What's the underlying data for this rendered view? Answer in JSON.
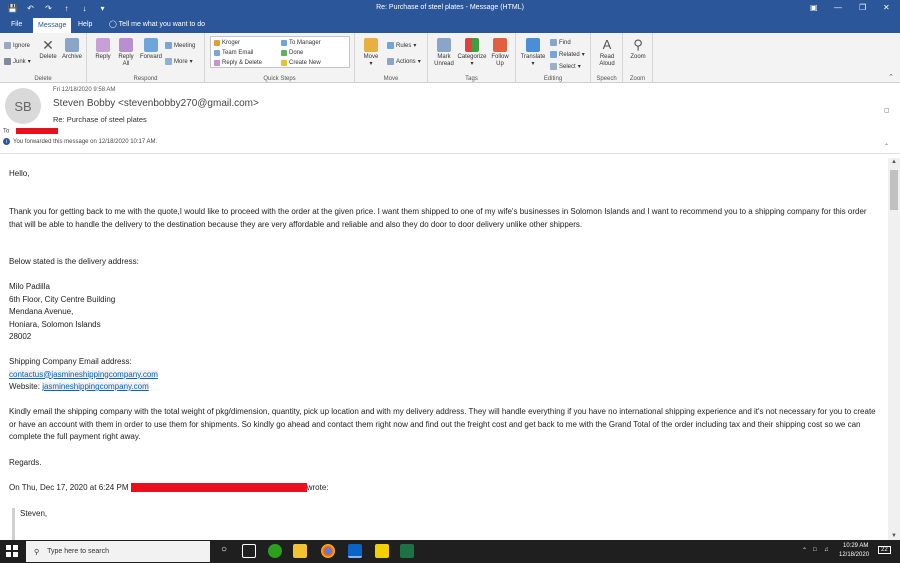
{
  "window": {
    "title": "Re: Purchase of steel plates  -  Message (HTML)"
  },
  "tabs": [
    {
      "label": "File"
    },
    {
      "label": "Message"
    },
    {
      "label": "Help"
    }
  ],
  "tell_me": "Tell me what you want to do",
  "ribbon": {
    "delete": {
      "ignore": "Ignore",
      "junk": "Junk",
      "delete": "Delete",
      "archive": "Archive",
      "group": "Delete"
    },
    "respond": {
      "reply": "Reply",
      "reply_all_1": "Reply",
      "reply_all_2": "All",
      "forward": "Forward",
      "meeting": "Meeting",
      "more": "More",
      "group": "Respond"
    },
    "quick_steps": {
      "items": [
        "Kroger",
        "Team Email",
        "Reply & Delete",
        "To Manager",
        "Done",
        "Create New"
      ],
      "group": "Quick Steps"
    },
    "move": {
      "move": "Move",
      "rules": "Rules",
      "actions": "Actions",
      "group": "Move"
    },
    "tags": {
      "mark_unread_1": "Mark",
      "mark_unread_2": "Unread",
      "categorize": "Categorize",
      "follow_up_1": "Follow",
      "follow_up_2": "Up",
      "group": "Tags"
    },
    "editing": {
      "translate": "Translate",
      "find": "Find",
      "related": "Related",
      "select": "Select",
      "group": "Editing"
    },
    "speech": {
      "read_aloud_1": "Read",
      "read_aloud_2": "Aloud",
      "group": "Speech"
    },
    "zoom": {
      "zoom": "Zoom",
      "group": "Zoom"
    }
  },
  "message": {
    "avatar_initials": "SB",
    "date": "Fri 12/18/2020 9:58 AM",
    "from": "Steven Bobby <stevenbobby270@gmail.com>",
    "subject": "Re: Purchase of steel plates",
    "to_label": "To",
    "info": "You forwarded this message on 12/18/2020 10:17 AM."
  },
  "body": {
    "greeting": "Hello,",
    "para1": "Thank you for getting back to me with the quote,I would like to proceed with the order at the given price. I want them shipped to one of my wife's businesses in Solomon Islands and I want to recommend you to a shipping company for this order that will be able to handle the delivery to the destination because they are very affordable and reliable and also they do door to door delivery unlike other shippers.",
    "address_intro": "Below stated is the delivery address:",
    "address": [
      "Milo Padilla",
      "6th Floor, City Centre Building",
      "Mendana Avenue,",
      "Honiara, Solomon Islands",
      "28002"
    ],
    "shipping_label": "Shipping Company Email address:",
    "shipping_email": "contactus@jasmineshippingcompany.com",
    "website_label": "Website: ",
    "website": "jasmineshippingcompany.com",
    "para2": "Kindly email the shipping company with the total weight of pkg/dimension, quantity, pick up location and with my delivery address. They will handle everything if you have no international shipping experience and it's not necessary for you to create or have an account with them in order to use them for shipments. So kindly go ahead and contact them right now and find out the freight cost and get back to me with the Grand Total of the order including tax and their shipping cost so we can complete the full payment right away.",
    "regards": "Regards.",
    "quote_intro": "On Thu, Dec 17, 2020 at 6:24 PM",
    "quote_wrote": "wrote:",
    "quote_line": "Steven,"
  },
  "taskbar": {
    "search_placeholder": "Type here to search",
    "time": "10:29 AM",
    "date": "12/18/2020",
    "notif": "22"
  },
  "colors": {
    "accent": "#2b579a",
    "redaction": "#e8101d",
    "link": "#0563c1"
  }
}
